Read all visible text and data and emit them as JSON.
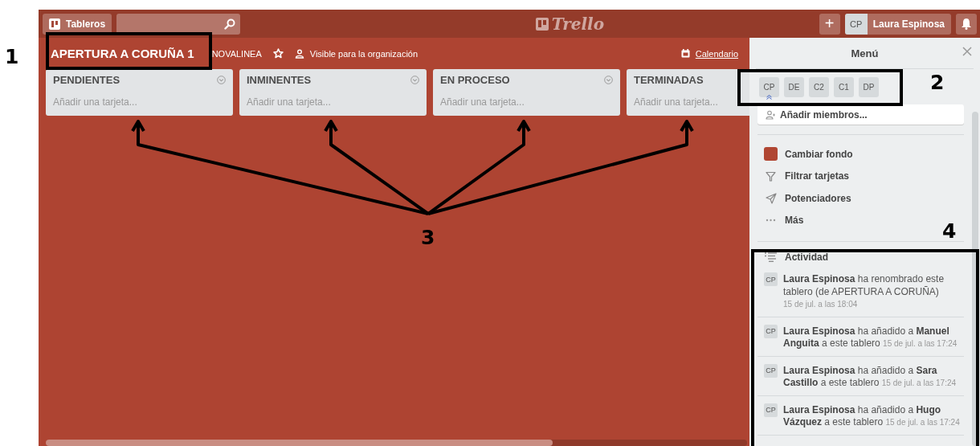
{
  "header": {
    "boards_button": "Tableros",
    "logo": "Trello",
    "create_button": "+",
    "user": {
      "initials": "CP",
      "name": "Laura Espinosa"
    }
  },
  "board": {
    "title": "APERTURA A CORUÑA 1",
    "team": "NOVALINEA",
    "starred": false,
    "visibility": "Visible para la organización",
    "calendar": "Calendario",
    "lists": [
      {
        "name": "PENDIENTES",
        "add_card": "Añadir una tarjeta..."
      },
      {
        "name": "INMINENTES",
        "add_card": "Añadir una tarjeta..."
      },
      {
        "name": "EN PROCESO",
        "add_card": "Añadir una tarjeta..."
      },
      {
        "name": "TERMINADAS",
        "add_card": "Añadir una tarjeta..."
      }
    ]
  },
  "menu": {
    "title": "Menú",
    "members": [
      {
        "initials": "CP",
        "admin": true
      },
      {
        "initials": "DE",
        "admin": false
      },
      {
        "initials": "C2",
        "admin": false
      },
      {
        "initials": "C1",
        "admin": false
      },
      {
        "initials": "DP",
        "admin": false
      }
    ],
    "add_members": "Añadir miembros...",
    "items": [
      {
        "kind": "background",
        "label": "Cambiar fondo",
        "color": "#b04632"
      },
      {
        "kind": "filter",
        "label": "Filtrar tarjetas"
      },
      {
        "kind": "powerups",
        "label": "Potenciadores"
      },
      {
        "kind": "more",
        "label": "Más"
      }
    ],
    "activity": {
      "title": "Actividad",
      "entries": [
        {
          "initials": "CP",
          "text": "**Laura Espinosa** ha renombrado este tablero (de APERTURA A CORUÑA)",
          "time": "15 de jul. a las 18:04"
        },
        {
          "initials": "CP",
          "text": "**Laura Espinosa** ha añadido a **Manuel Anguita** a este tablero",
          "time": "15 de jul. a las 17:24"
        },
        {
          "initials": "CP",
          "text": "**Laura Espinosa** ha añadido a **Sara Castillo** a este tablero",
          "time": "15 de jul. a las 17:24"
        },
        {
          "initials": "CP",
          "text": "**Laura Espinosa** ha añadido a **Hugo Vázquez** a este tablero",
          "time": "15 de jul. a las 17:24"
        }
      ]
    }
  },
  "annotations": [
    {
      "label": "1"
    },
    {
      "label": "2"
    },
    {
      "label": "3"
    },
    {
      "label": "4"
    }
  ]
}
